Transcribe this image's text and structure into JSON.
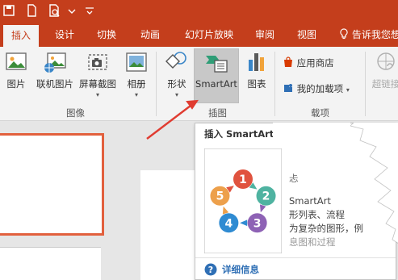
{
  "titlebar": {
    "icons": [
      "save-icon",
      "new-file-icon",
      "print-preview-icon",
      "customize-dropdown-icon"
    ]
  },
  "tabs": [
    {
      "label": "插入",
      "active": true
    },
    {
      "label": "设计"
    },
    {
      "label": "切换"
    },
    {
      "label": "动画"
    },
    {
      "label": "幻灯片放映"
    },
    {
      "label": "审阅"
    },
    {
      "label": "视图"
    }
  ],
  "tell_me": {
    "icon": "lightbulb-icon",
    "label": "告诉我您想"
  },
  "ribbon": {
    "images_group": {
      "label": "图像",
      "buttons": [
        {
          "label": "图片",
          "icon": "picture-icon"
        },
        {
          "label": "联机图片",
          "icon": "online-picture-icon"
        },
        {
          "label": "屏幕截图",
          "icon": "screenshot-icon"
        },
        {
          "label": "相册",
          "icon": "photo-album-icon"
        }
      ]
    },
    "illustrations_group": {
      "label": "插图",
      "buttons": [
        {
          "label": "形状",
          "icon": "shapes-icon"
        },
        {
          "label": "SmartArt",
          "icon": "smartart-icon"
        },
        {
          "label": "图表",
          "icon": "chart-icon"
        }
      ]
    },
    "addins_group": {
      "label_fragment": "载项",
      "items": [
        {
          "label": "应用商店",
          "icon": "store-icon"
        },
        {
          "label": "我的加载项",
          "icon": "my-addins-icon"
        }
      ]
    },
    "links_group": {
      "label": "超链接",
      "icon": "hyperlink-icon"
    }
  },
  "tooltip": {
    "title": "插入 SmartArt",
    "desc_head": "忐",
    "desc_lines": [
      "SmartArt",
      "形列表、流程",
      "为复杂的图形，例",
      "息图和过程"
    ],
    "more_info": "详细信息",
    "help_icon": "help-icon",
    "cycle_numbers": [
      "1",
      "2",
      "3",
      "4",
      "5"
    ],
    "cycle_colors": [
      "#e0533f",
      "#4fb3a1",
      "#8e62b5",
      "#2f8bd2",
      "#eda04b"
    ]
  },
  "colors": {
    "accent": "#c43e1c",
    "arrow": "#e03c31"
  }
}
